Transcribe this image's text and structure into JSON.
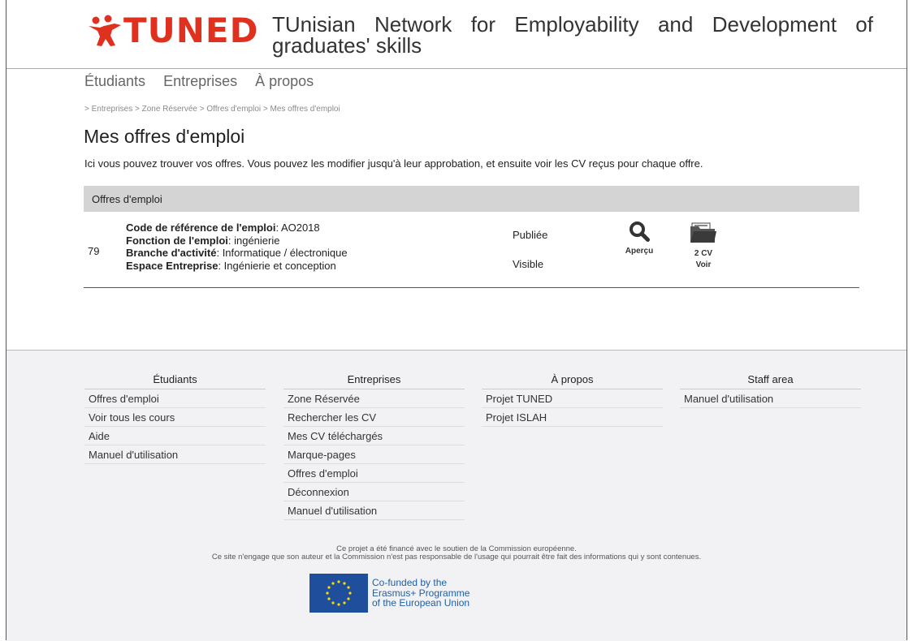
{
  "header": {
    "logo_text": "TUNED",
    "site_title": "TUnisian Network for Employability and Development of graduates' skills"
  },
  "nav": {
    "items": [
      {
        "label": "Étudiants"
      },
      {
        "label": "Entreprises"
      },
      {
        "label": "À propos"
      }
    ]
  },
  "breadcrumb": "> Entreprises > Zone Réservée > Offres d'emploi > Mes offres d'emploi",
  "page": {
    "title": "Mes offres d'emploi",
    "intro": "Ici vous pouvez trouver vos offres. Vous pouvez les modifier jusqu'à leur approbation, et ensuite voir les CV reçus pour chaque offre."
  },
  "table": {
    "header": "Offres d'emploi",
    "rows": [
      {
        "id": "79",
        "code_label": "Code de référence de l'emploi",
        "code_value": ": AO2018",
        "function_label": "Fonction de l'emploi",
        "function_value": ": ingénierie",
        "branch_label": "Branche d'activité",
        "branch_value": ": Informatique / électronique",
        "space_label": "Espace Entreprise",
        "space_value": ": Ingénierie et conception",
        "status_published": "Publiée",
        "status_visible": "Visible",
        "preview_label": "Aperçu",
        "cv_count": "2 CV",
        "view_label": "Voir"
      }
    ]
  },
  "footer": {
    "columns": [
      {
        "title": "Étudiants",
        "items": [
          "Offres d'emploi",
          "Voir tous les cours",
          "Aide",
          "Manuel d'utilisation"
        ]
      },
      {
        "title": "Entreprises",
        "items": [
          "Zone Réservée",
          "Rechercher les CV",
          "Mes CV téléchargés",
          "Marque-pages",
          "Offres d'emploi",
          "Déconnexion",
          "Manuel d'utilisation"
        ]
      },
      {
        "title": "À propos",
        "items": [
          "Projet TUNED",
          "Projet ISLAH"
        ]
      },
      {
        "title": "Staff area",
        "items": [
          "Manuel d'utilisation"
        ]
      }
    ],
    "disclaimer_1": "Ce projet a été financé avec le soutien de la Commission européenne.",
    "disclaimer_2": "Ce site n'engage que son auteur et la Commission n'est pas responsable de l'usage qui pourrait être fait des informations qui y sont contenues.",
    "eu_line1": "Co-funded by the",
    "eu_line2": "Erasmus+ Programme",
    "eu_line3": "of the European Union"
  },
  "colors": {
    "brand_red": "#e0311e",
    "eu_blue": "#1f4f9c",
    "eu_star": "#ffdd00"
  }
}
